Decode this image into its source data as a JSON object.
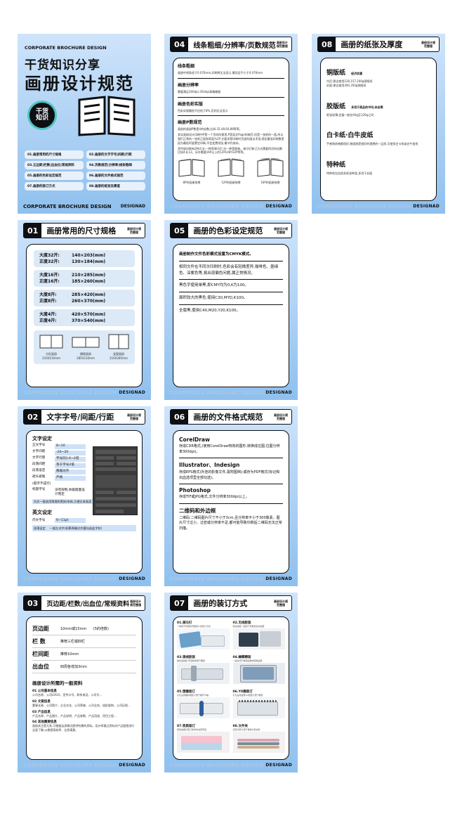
{
  "cover": {
    "top_label": "CORPORATE BROCHURE DESIGN",
    "line1": "干货知识分享",
    "line2": "画册设计规范",
    "badge_line1": "干货",
    "badge_line2": "知识",
    "menu": [
      "01.画册常用的尺寸规格",
      "02.画册的文字字号|间距|行距",
      "03.五边距|栏数|出血位|常规资料",
      "04.页数规范|分辨率|线条粗细",
      "05.画册的色彩设定规范",
      "06.画册的文件格式规范",
      "07.画册的装订方式",
      "08.画册的纸张及厚度"
    ],
    "footer": "CORPORATE BROCHURE DESIGN",
    "brand": "DESIGNAD"
  },
  "p04": {
    "num": "04",
    "title": "线条粗细/分辨率/页数规范",
    "sub": "画册设计规范整理",
    "s1_title": "线条粗细",
    "s1_text": "画册中线条低于0.076mm,印刷将无法显示,需设定不小于0.076mm",
    "s2_title": "画册分辨率",
    "s2_text": "需要满足300dpi-350dpi高精精细",
    "s3_title": "画册色彩实版",
    "s3_text": "色彩实版最低不应低于8%,否则无法显示",
    "s4_title": "画册P数规范",
    "s4_text1": "画册的画册P数是4的倍数,比如:32,48,60,88等等。",
    "s4_text2": "其实画册设计印刷中P是一个页码的意思,P是英文Page的缩写,但是一张纸的一面,所以我们正常的一张纸正面和背面为2P,它要求是印刷时页面的展法术语,规定最低印刷数是因为最低阿爱蒙定印刷,不会变费纸张,最节约成本。",
    "s4_text3": "宣传册印刷有2种方法:一种是骑马钉,另一种是胶装。骑马钉装订方式需要四页的倍数比如4,8,12。另外需要16P以上的12P/24P/32P等等。",
    "books": [
      "8P的画册效果",
      "12P的画册效果",
      "16P的画册效果"
    ],
    "footer": "CORPORATE BROCHURE DESIGN",
    "brand": "DESIGNAD"
  },
  "p08": {
    "num": "08",
    "title": "画册的纸张及厚度",
    "sub": "画册设计规范整理",
    "papers": [
      {
        "name": "铜版纸",
        "note": "经济实惠",
        "lines": [
          "内页:建议使用128,157,200g铜版纸",
          "封面:建议使用300,350g铜版纸"
        ]
      },
      {
        "name": "胶版纸",
        "note": "多用于高品的书刊,杂志等",
        "lines": [
          "纸张较薄,定量一般在60g至120g之间"
        ]
      },
      {
        "name": "白卡纸·白牛皮纸",
        "note": "",
        "lines": [
          "手感和质感都很好,做画册是很好的理想的一品质,可使用白卡纸或白牛皮纸"
        ]
      },
      {
        "name": "特种纸",
        "note": "",
        "lines": [
          "特种纸包含很多纸张种类,多用于封面"
        ]
      }
    ],
    "footer": "CORPORATE BROCHURE DESIGN",
    "brand": "DESIGNAD"
  },
  "p01": {
    "num": "01",
    "title": "画册常用的尺寸规格",
    "sub": "画册设计规范整理",
    "sizes": [
      {
        "a": "大度32开:",
        "av": "140×203(mm)",
        "b": "正度32开:",
        "bv": "130×184(mm)"
      },
      {
        "a": "大度16开:",
        "av": "210×285(mm)",
        "b": "正度16开:",
        "bv": "185×260(mm)"
      },
      {
        "a": "大度8开:",
        "av": "285×420(mm)",
        "b": "正度8开:",
        "bv": "260×370(mm)"
      },
      {
        "a": "大度4开:",
        "av": "420×570(mm)",
        "b": "正度4开:",
        "bv": "370×540(mm)"
      }
    ],
    "formats": [
      {
        "name": "方形画册",
        "size": "210X210mm"
      },
      {
        "name": "横版画册",
        "size": "285X210mm"
      },
      {
        "name": "竖版画册",
        "size": "210X285mm"
      }
    ],
    "footer": "CORPORATE BROCHURE DESIGN",
    "brand": "DESIGNAD"
  },
  "p05": {
    "num": "05",
    "title": "画册的色彩设定规范",
    "sub": "画册设计规范整理",
    "t1": "画册制作文件色彩模式设置为CMYK模式。",
    "t2": "相同文件在不同次印刷时,色彩会有轻微差异,咖啡色、墨绿色、深紫色等,易出现偏色问题,属正常情况。",
    "t3": "黑色字使用单黑,即CMY均为0,K为100。",
    "t4": "面积较大的黑色,使用C30,MYO,K100。",
    "t5": "全版黑,使用C40,M20,Y20,K100。",
    "footer": "CORPORATE BROCHURE DESIGN",
    "brand": "DESIGNAD"
  },
  "p02": {
    "num": "02",
    "title": "文字字号/间距/行距",
    "sub": "画册设计规范整理",
    "sec1": "文字设定",
    "rows": [
      {
        "k": "正文字号",
        "v": "8~10"
      },
      {
        "k": "文字间距",
        "v": "-20~20"
      },
      {
        "k": "文字行距",
        "v": "字号的1.6~2倍"
      },
      {
        "k": "段落间距",
        "v": "等于字号2倍"
      },
      {
        "k": "段落设定",
        "v": "两端对齐"
      },
      {
        "k": "避头避尾",
        "v": "严格"
      }
    ],
    "note1": "(孤字不成行)",
    "note2k": "标题字号",
    "note2v": "没有限制,依据版面设计而定",
    "note3": "内文一般选用常规的黑体/宋体,方便文本阅读",
    "sec2": "英文设定",
    "erow_k": "内文字号",
    "erow_v": "6~11pt",
    "erow2_k": "段落设定",
    "erow2_v": "一般左对齐(如果两端对齐要勾选连字符)",
    "footer": "CORPORATE BROCHURE DESIGN",
    "brand": "DESIGNAD"
  },
  "p06": {
    "num": "06",
    "title": "画册的文件格式规范",
    "sub": "画册设计规范整理",
    "items": [
      {
        "h": "CorelDraw",
        "t": "存成CDR格式,(使用CorelDraw特效的图形,转换成位图,位图分辨率300dpi)。"
      },
      {
        "h": "Illustrator、Indesign",
        "t": "存成EPS格式(外挂的影像文件,需附图档);或存为PDF格式(标记和出血选项里全部勾选)。"
      },
      {
        "h": "Photoshop",
        "t": "存成TIF或JPG格式,文件分辨率300dpi以上。"
      },
      {
        "h": "二维码和外边框",
        "t": "二维码:二维码图片尺寸不小于3cm,且分辨率不小于300像素。图片尺寸过小、过密或分辨率不足,都可能导致印刷后二维码无法正常扫描。"
      }
    ],
    "footer": "CORPORATE BROCHURE DESIGN",
    "brand": "DESIGNAD"
  },
  "p03": {
    "num": "03",
    "title": "页边距/栏数/出血位/常规资料",
    "sub": "画册设计规范整理",
    "rows": [
      {
        "k": "页边距",
        "v": "10mm或15mm      (5的倍数)"
      },
      {
        "k": "栏 数",
        "v": "推荐三栏或四栏"
      },
      {
        "k": "栏间距",
        "v": "推荐10mm"
      },
      {
        "k": "出血位",
        "v": "四周各增加3mm"
      }
    ],
    "sec": "画册设计所需的一般资料",
    "items": [
      {
        "h": "01 公司基本信息",
        "t": "公司名称、公司LOGO、宣传口号、联系电话、公司号..."
      },
      {
        "h": "02 文案信息",
        "t": "董事长致、公司简介、企业文化、公司荣誉、公司业务、组织架构、公司历程..."
      },
      {
        "h": "03 产品信息",
        "t": "产品名称、产品图片、产品说明、产品参数、产品用途、项目工程..."
      },
      {
        "h": "04 其他重要信息",
        "t": "画册关注是尤其,可根据自身情况提供所需的资料。设计师通过资料对产品配图进行全面了解,以便提高效率、达到满意。"
      }
    ],
    "footer": "CORPORATE BROCHURE DESIGN",
    "brand": "DESIGNAD"
  },
  "p07": {
    "num": "07",
    "title": "画册的装订方式",
    "sub": "画册设计规范整理",
    "bindings": [
      {
        "h": "01.骑马钉",
        "t": "一种用于较薄的页数较少的装订方式"
      },
      {
        "h": "02.无线胶装",
        "t": "侧边涂胶一般用于页数较多的画册"
      },
      {
        "h": "03.锁线胶装",
        "t": "锁线后胶装,牢固耐用便于翻阅"
      },
      {
        "h": "04.蝴蝶精装",
        "t": "一般多用于精装画册或特殊画册"
      },
      {
        "h": "05.塑圈装订",
        "t": "打孔后用塑料圈装订便于翻开平摊"
      },
      {
        "h": "06.YO圈装订",
        "t": "打孔后用金属YO圈装订便于翻页"
      },
      {
        "h": "07.铁质装订",
        "t": "使用金属钉装订整体简洁而牢固"
      },
      {
        "h": "08.文件夹",
        "t": "活页式装订便于更换内页资料"
      }
    ],
    "footer": "CORPORATE BROCHURE DESIGN",
    "brand": "DESIGNAD"
  }
}
